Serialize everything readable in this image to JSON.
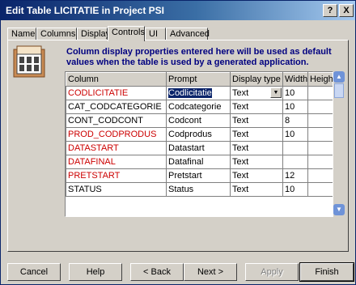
{
  "window": {
    "title": "Edit Table LICITATIE in Project PSI"
  },
  "title_buttons": {
    "help": "?",
    "close": "X"
  },
  "tabs": [
    {
      "label": "Name"
    },
    {
      "label": "Columns"
    },
    {
      "label": "Display"
    },
    {
      "label": "Controls"
    },
    {
      "label": "UI"
    },
    {
      "label": "Advanced"
    }
  ],
  "active_tab": "Controls",
  "description": "Column display properties entered here will be used as default values when the table is used by a generated application.",
  "grid": {
    "headers": [
      "Column",
      "Prompt",
      "Display type",
      "Width",
      "Height"
    ],
    "rows": [
      {
        "column": "CODLICITATIE",
        "prompt": "Codlicitatie",
        "type": "Text",
        "width": "10",
        "height": "",
        "required": true,
        "selected": true
      },
      {
        "column": "CAT_CODCATEGORIE",
        "prompt": "Codcategorie",
        "type": "Text",
        "width": "10",
        "height": "",
        "required": false
      },
      {
        "column": "CONT_CODCONT",
        "prompt": "Codcont",
        "type": "Text",
        "width": "8",
        "height": "",
        "required": false
      },
      {
        "column": "PROD_CODPRODUS",
        "prompt": "Codprodus",
        "type": "Text",
        "width": "10",
        "height": "",
        "required": true
      },
      {
        "column": "DATASTART",
        "prompt": "Datastart",
        "type": "Text",
        "width": "",
        "height": "",
        "required": true
      },
      {
        "column": "DATAFINAL",
        "prompt": "Datafinal",
        "type": "Text",
        "width": "",
        "height": "",
        "required": true
      },
      {
        "column": "PRETSTART",
        "prompt": "Pretstart",
        "type": "Text",
        "width": "12",
        "height": "",
        "required": true
      },
      {
        "column": "STATUS",
        "prompt": "Status",
        "type": "Text",
        "width": "10",
        "height": "",
        "required": false
      }
    ]
  },
  "buttons": {
    "cancel": "Cancel",
    "help": "Help",
    "back": "< Back",
    "next": "Next >",
    "apply": "Apply",
    "finish": "Finish"
  },
  "colors": {
    "required_text": "#cc0000",
    "description_text": "#000080",
    "selection": "#0a246a"
  }
}
